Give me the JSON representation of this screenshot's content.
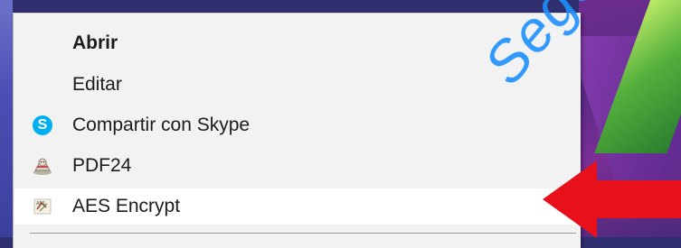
{
  "menu": {
    "items": [
      {
        "label": "Abrir",
        "icon": ""
      },
      {
        "label": "Editar",
        "icon": ""
      },
      {
        "label": "Compartir con Skype",
        "icon": "skype-icon"
      },
      {
        "label": "PDF24",
        "icon": "pdf24-icon"
      },
      {
        "label": "AES Encrypt",
        "icon": "aes-encrypt-icon"
      }
    ],
    "selected_index": 4
  },
  "skype_glyph": "S",
  "watermark": "Seguri",
  "colors": {
    "arrow": "#e8101a",
    "skype": "#00aff0",
    "watermark": "#1e90ff",
    "menu_bg": "#f2f2f2",
    "selected_bg": "#ffffff"
  }
}
